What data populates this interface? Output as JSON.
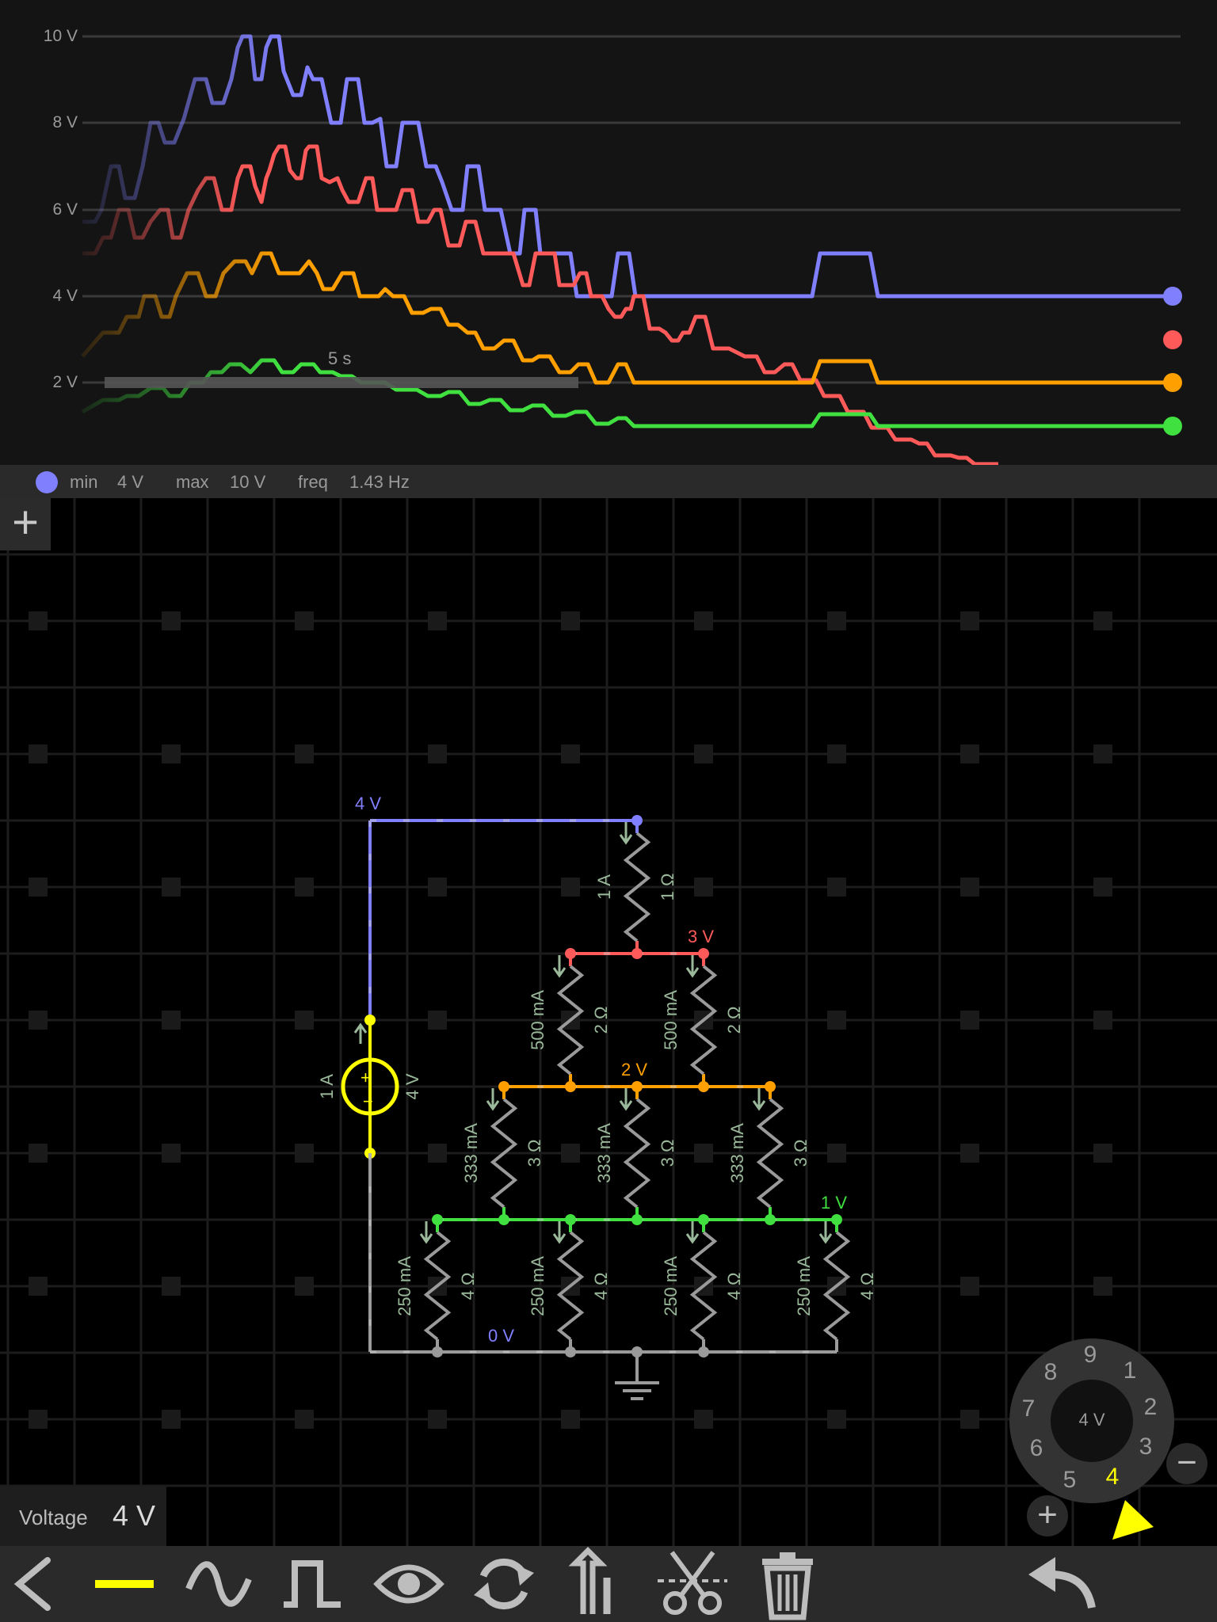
{
  "scope": {
    "y_labels": [
      "10 V",
      "8 V",
      "6 V",
      "4 V",
      "2 V"
    ],
    "time_label": "5 s",
    "colors": {
      "blue": "#8080ff",
      "red": "#ff5a5a",
      "orange": "#ffa000",
      "green": "#40e040"
    }
  },
  "infobar": {
    "min_label": "min",
    "min_value": "4 V",
    "max_label": "max",
    "max_value": "10 V",
    "freq_label": "freq",
    "freq_value": "1.43 Hz"
  },
  "add_scope_symbol": "+",
  "circuit": {
    "node_labels": {
      "top": "4 V",
      "r1": "3 V",
      "r2": "2 V",
      "r3": "1 V",
      "ground": "0 V"
    },
    "source": {
      "current": "1 A",
      "voltage": "4 V"
    },
    "r1": {
      "current": "1 A",
      "resistance": "1 Ω"
    },
    "r2_current": "500 mA",
    "r2_resistance": "2 Ω",
    "r3_current": "333 mA",
    "r3_resistance": "3 Ω",
    "r4_current": "250 mA",
    "r4_resistance": "4 Ω"
  },
  "voltage_panel": {
    "label": "Voltage",
    "value": "4 V"
  },
  "dial": {
    "center": "4 V",
    "numbers": [
      "9",
      "1",
      "2",
      "3",
      "4",
      "5",
      "6",
      "7",
      "8"
    ],
    "selected": "4",
    "plus": "+",
    "minus": "−"
  },
  "toolbar": {
    "icons": [
      "back-icon",
      "dc-wire-icon",
      "sine-wave-icon",
      "square-wave-icon",
      "eye-icon",
      "rotate-icon",
      "flip-icon",
      "cut-icon",
      "trash-icon",
      "undo-icon"
    ]
  }
}
